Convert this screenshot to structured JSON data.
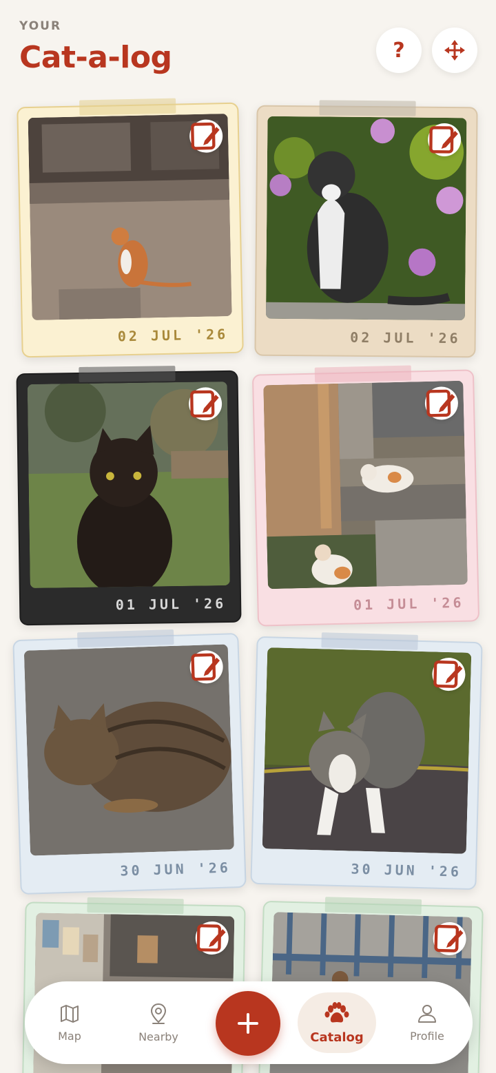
{
  "header": {
    "eyebrow": "YOUR",
    "title": "Cat-a-log",
    "help_label": "?"
  },
  "icons": {
    "help": "question-mark-icon",
    "move": "move-arrows-icon",
    "edit": "edit-pencil-icon",
    "map": "map-icon",
    "nearby": "location-pin-icon",
    "add": "plus-icon",
    "catalog": "paw-icon",
    "profile": "person-icon"
  },
  "colors": {
    "accent": "#b8361f",
    "background": "#f7f4ef"
  },
  "cards": [
    {
      "date": "02 JUL '26",
      "frame": "#fbf1d2",
      "border": "#e7d08e",
      "date_color": "#a9893a",
      "tape": "#e4cf8f"
    },
    {
      "date": "02 JUL '26",
      "frame": "#ecdcc4",
      "border": "#d9c6a9",
      "date_color": "#8f7e66",
      "tape": "#bdb6a8"
    },
    {
      "date": "01 JUL '26",
      "frame": "#2b2b2b",
      "border": "#1e1e1e",
      "date_color": "#d8d8d8",
      "tape": "#555555"
    },
    {
      "date": "01 JUL '26",
      "frame": "#f9dfe3",
      "border": "#eec1c8",
      "date_color": "#c58d96",
      "tape": "#ecb3bd"
    },
    {
      "date": "30 JUN '26",
      "frame": "#e4ecf3",
      "border": "#c8d6e4",
      "date_color": "#7b8ea3",
      "tape": "#b9c7d7"
    },
    {
      "date": "30 JUN '26",
      "frame": "#e4ecf3",
      "border": "#c8d6e4",
      "date_color": "#7b8ea3",
      "tape": "#b9c7d7"
    },
    {
      "date": "",
      "frame": "#e2f0e2",
      "border": "#c2dcc3",
      "date_color": "#7aa07c",
      "tape": "#b6d3b7"
    },
    {
      "date": "",
      "frame": "#e2f0e2",
      "border": "#c2dcc3",
      "date_color": "#7aa07c",
      "tape": "#b6d3b7"
    }
  ],
  "nav": {
    "items": [
      {
        "label": "Map"
      },
      {
        "label": "Nearby"
      },
      {
        "label": "Catalog"
      },
      {
        "label": "Profile"
      }
    ],
    "active": "Catalog"
  }
}
